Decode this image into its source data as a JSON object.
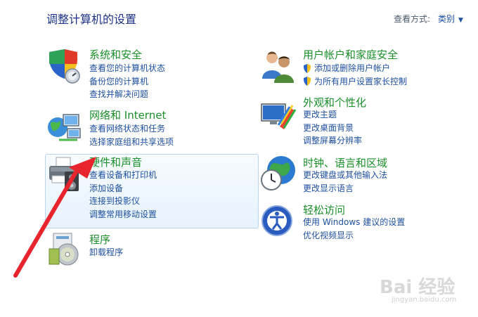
{
  "header": {
    "title": "调整计算机的设置",
    "view_label": "查看方式:",
    "view_value": "类别"
  },
  "left_categories": [
    {
      "title": "系统和安全",
      "icon": "system-security-icon",
      "links": [
        "查看您的计算机状态",
        "备份您的计算机",
        "查找并解决问题"
      ]
    },
    {
      "title": "网络和 Internet",
      "icon": "network-icon",
      "links": [
        "查看网络状态和任务",
        "选择家庭组和共享选项"
      ]
    },
    {
      "title": "硬件和声音",
      "icon": "printer-icon",
      "links": [
        "查看设备和打印机",
        "添加设备",
        "连接到投影仪",
        "调整常用移动设置"
      ]
    },
    {
      "title": "程序",
      "icon": "programs-icon",
      "links": [
        "卸载程序"
      ]
    }
  ],
  "right_categories": [
    {
      "title": "用户帐户和家庭安全",
      "icon": "users-icon",
      "links": [
        "添加或删除用户帐户",
        "为所有用户设置家长控制"
      ]
    },
    {
      "title": "外观和个性化",
      "icon": "appearance-icon",
      "links": [
        "更改主题",
        "更改桌面背景",
        "调整屏幕分辨率"
      ]
    },
    {
      "title": "时钟、语言和区域",
      "icon": "clock-globe-icon",
      "links": [
        "更改键盘或其他输入法",
        "更改显示语言"
      ]
    },
    {
      "title": "轻松访问",
      "icon": "ease-of-access-icon",
      "links": [
        "使用 Windows 建议的设置",
        "优化视频显示"
      ]
    }
  ],
  "watermark": {
    "brand": "Bai 经验",
    "url": "jingyan.baidu.com"
  },
  "colors": {
    "title": "#1e3287",
    "category": "#1a8f2a",
    "link": "#1e50a0",
    "arrow": "#e8242c"
  }
}
